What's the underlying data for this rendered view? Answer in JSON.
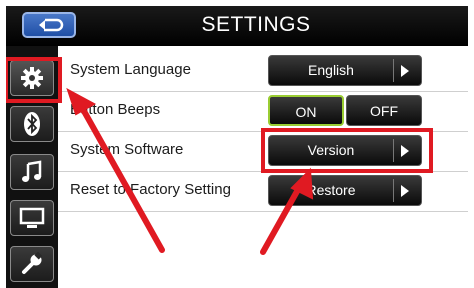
{
  "header": {
    "title": "SETTINGS"
  },
  "settings": [
    {
      "label": "System Language",
      "value": "English"
    },
    {
      "label": "Button Beeps",
      "on": "ON",
      "off": "OFF"
    },
    {
      "label": "System Software",
      "value": "Version"
    },
    {
      "label": "Reset to Factory Setting",
      "value": "Restore"
    }
  ],
  "sidebar": [
    "gear-icon",
    "bluetooth-icon",
    "music-icon",
    "display-icon",
    "wrench-icon"
  ],
  "annotation": {
    "color": "#e01a22"
  }
}
